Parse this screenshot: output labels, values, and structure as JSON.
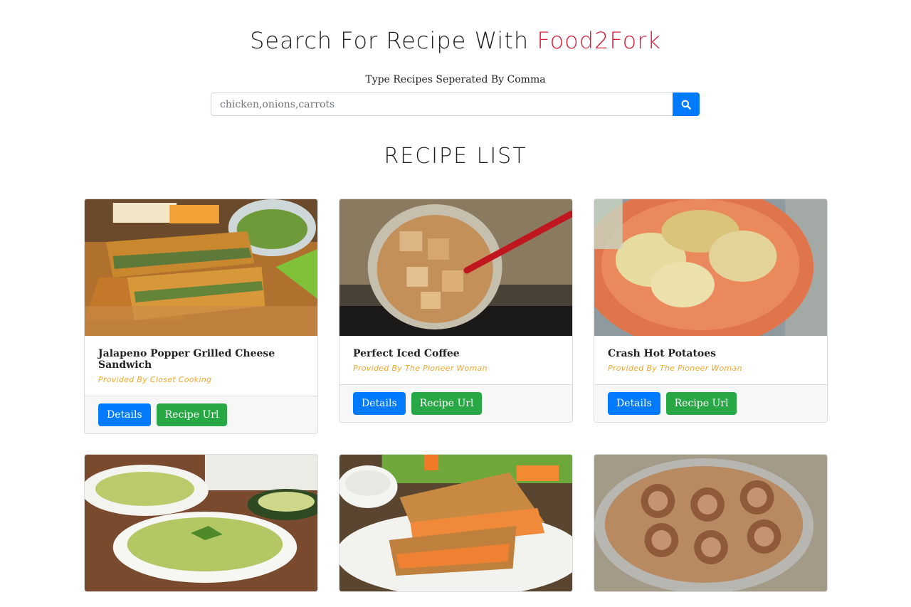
{
  "header": {
    "title_prefix": "Search For Recipe With ",
    "title_brand": "Food2Fork",
    "brand_color": "#d6203d"
  },
  "search": {
    "hint": "Type Recipes Seperated By Comma",
    "placeholder": "chicken,onions,carrots",
    "button_icon": "search-icon",
    "button_color": "#007bff"
  },
  "list": {
    "title": "RECIPE LIST",
    "recipes": [
      {
        "title": "Jalapeno Popper Grilled Cheese Sandwich",
        "publisher": "Provided By Closet Cooking",
        "image": "grilled-cheese-sandwich"
      },
      {
        "title": "Perfect Iced Coffee",
        "publisher": "Provided By The Pioneer Woman",
        "image": "iced-coffee"
      },
      {
        "title": "Crash Hot Potatoes",
        "publisher": "Provided By The Pioneer Woman",
        "image": "crash-hot-potatoes"
      },
      {
        "title": "",
        "publisher": "",
        "image": "avocado-pasta"
      },
      {
        "title": "",
        "publisher": "",
        "image": "buffalo-grilled-cheese"
      },
      {
        "title": "",
        "publisher": "",
        "image": "cinnamon-rolls"
      }
    ],
    "details_label": "Details",
    "url_label": "Recipe Url",
    "details_color": "#007bff",
    "url_color": "#28a745",
    "publisher_color": "#f0a830"
  }
}
